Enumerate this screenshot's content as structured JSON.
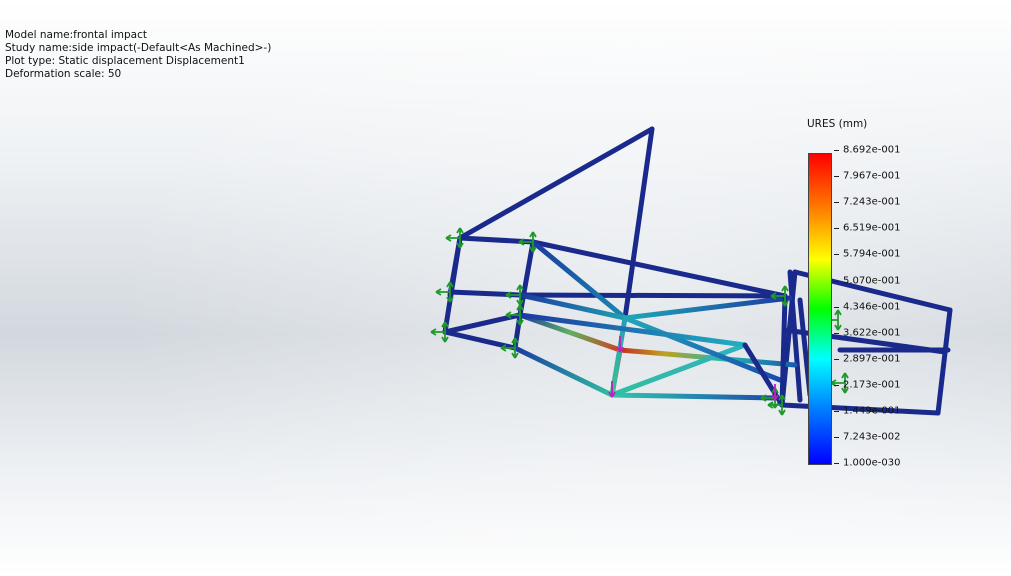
{
  "info": {
    "model_name": "Model name:frontal impact",
    "study_name": "Study name:side impact(-Default<As Machined>-)",
    "plot_type": "Plot type: Static displacement Displacement1",
    "deformation_scale": "Deformation scale: 50"
  },
  "legend": {
    "title": "URES (mm)",
    "labels": [
      "8.692e-001",
      "7.967e-001",
      "7.243e-001",
      "6.519e-001",
      "5.794e-001",
      "5.070e-001",
      "4.346e-001",
      "3.622e-001",
      "2.897e-001",
      "2.173e-001",
      "1.449e-001",
      "7.243e-002",
      "1.000e-030"
    ]
  },
  "colors": {
    "frame_blue": "#1a2a8c",
    "fixture_green": "#1f9a2a",
    "load_magenta": "#c01ec0"
  }
}
